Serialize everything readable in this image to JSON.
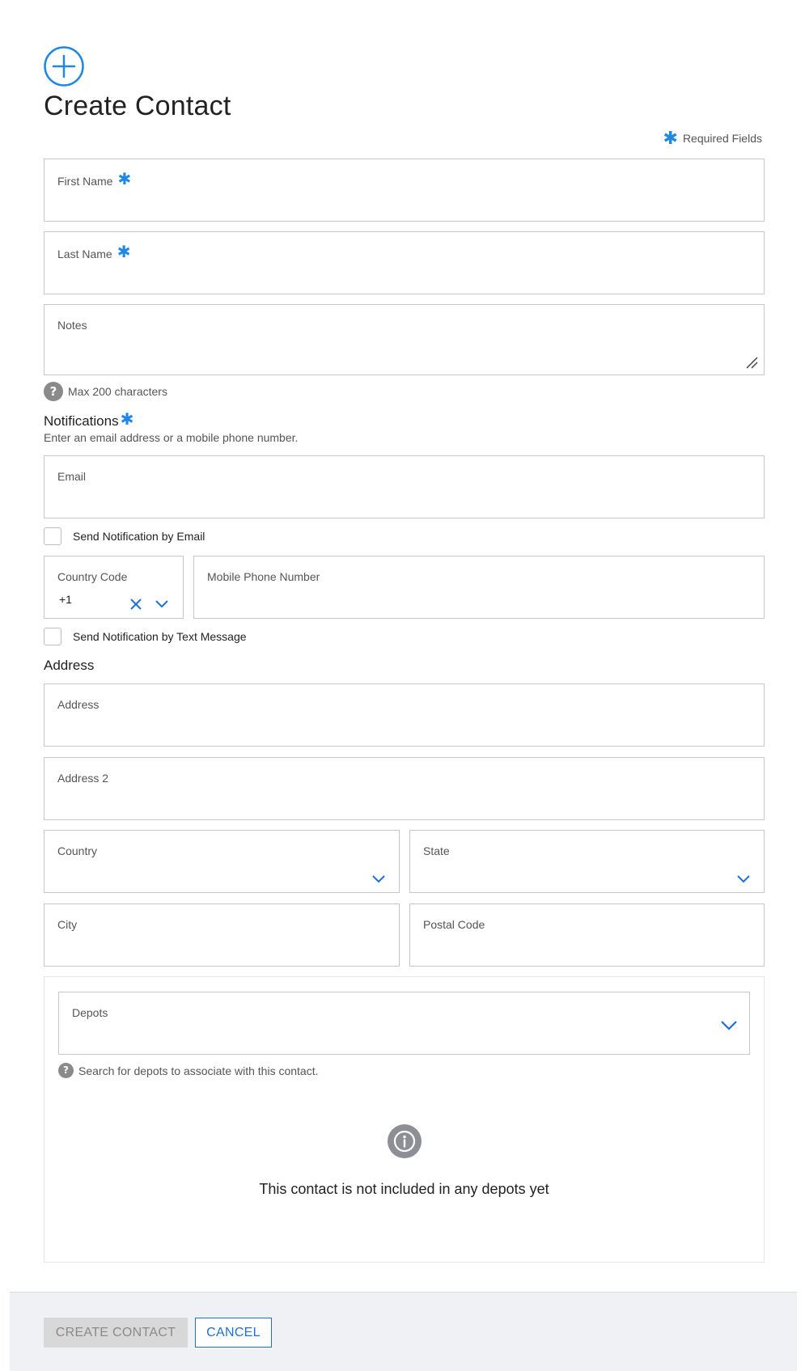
{
  "header": {
    "title": "Create Contact",
    "required_legend": "Required Fields"
  },
  "fields": {
    "first_name": {
      "label": "First Name",
      "value": ""
    },
    "last_name": {
      "label": "Last Name",
      "value": ""
    },
    "notes": {
      "label": "Notes",
      "value": "",
      "help": "Max 200 characters"
    }
  },
  "notifications": {
    "title": "Notifications",
    "subtitle": "Enter an email address or a mobile phone number.",
    "email_label": "Email",
    "send_email_label": "Send Notification by Email",
    "send_email_checked": false,
    "country_code_label": "Country Code",
    "country_code_value": "+1",
    "mobile_label": "Mobile Phone Number",
    "send_text_label": "Send Notification by Text Message",
    "send_text_checked": false
  },
  "address": {
    "title": "Address",
    "address_label": "Address",
    "address2_label": "Address 2",
    "country_label": "Country",
    "state_label": "State",
    "city_label": "City",
    "postal_label": "Postal Code"
  },
  "depots": {
    "label": "Depots",
    "help": "Search for depots to associate with this contact.",
    "empty_message": "This contact is not included in any depots yet"
  },
  "footer": {
    "create_label": "CREATE CONTACT",
    "cancel_label": "CANCEL"
  },
  "colors": {
    "accent": "#1e88e5",
    "link_blue": "#1e6fd9",
    "disabled_bg": "#d8d8d8",
    "footer_bg": "#f0f1f5"
  },
  "icons": {
    "header": "plus-circle-icon",
    "required": "asterisk-icon",
    "help": "question-circle-icon",
    "clear": "close-icon",
    "dropdown": "chevron-down-icon",
    "empty": "info-circle-icon",
    "resize": "resize-handle-icon"
  }
}
